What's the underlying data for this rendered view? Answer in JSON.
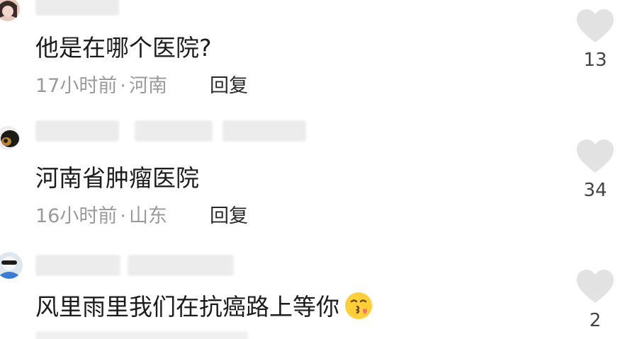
{
  "comments": [
    {
      "text": "他是在哪个医院?",
      "time": "17小时前",
      "location": "河南",
      "reply_label": "回复",
      "likes": "13",
      "avatar_icon": "user-avatar-icon"
    },
    {
      "text": "河南省肿瘤医院",
      "time": "16小时前",
      "location": "山东",
      "reply_label": "回复",
      "likes": "34",
      "avatar_icon": "user-avatar-icon"
    },
    {
      "text": "风里雨里我们在抗癌路上等你",
      "emoji": "face-blowing-kiss-emoji",
      "likes": "2",
      "avatar_icon": "user-avatar-icon"
    }
  ],
  "separator": "·",
  "colors": {
    "text": "#1c1c1c",
    "meta": "#9a9a9a",
    "heart": "#e2e2e2",
    "blur": "#ececec"
  }
}
